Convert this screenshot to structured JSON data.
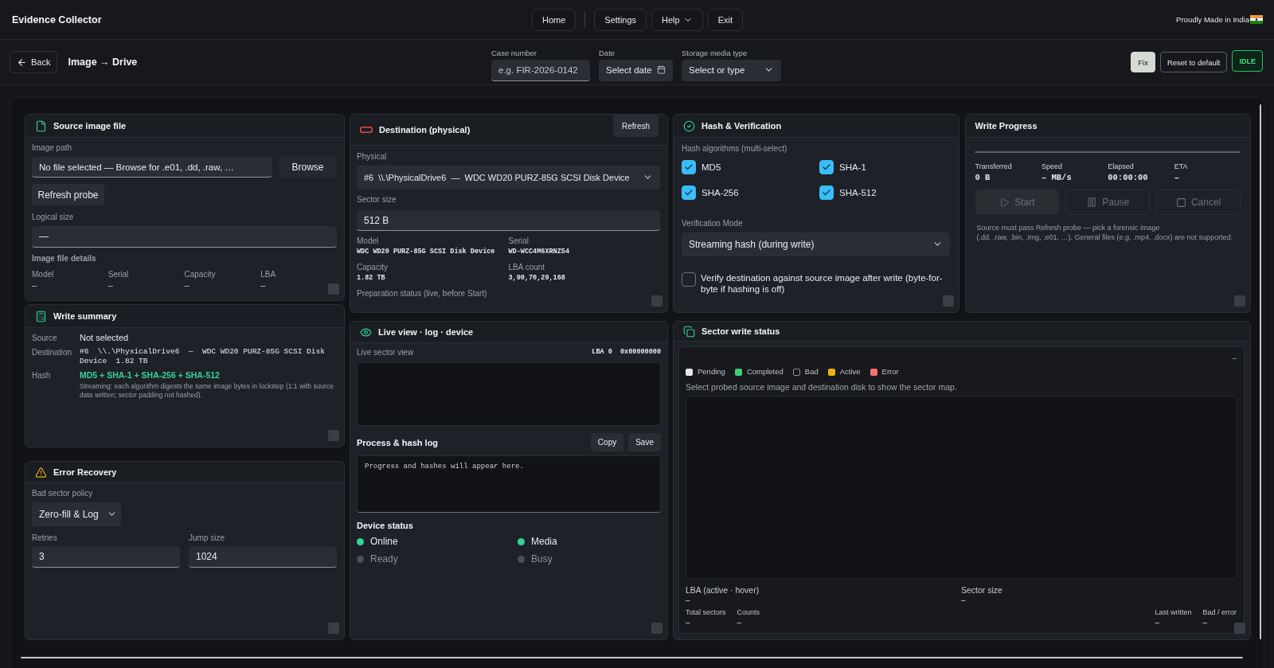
{
  "app": {
    "title": "Evidence Collector",
    "tagline": "Proudly Made in India"
  },
  "nav": [
    {
      "label": "Home",
      "kind": "button"
    },
    {
      "label": "Settings",
      "kind": "button"
    },
    {
      "label": "Help",
      "kind": "menu"
    },
    {
      "label": "Exit",
      "kind": "button"
    }
  ],
  "toolbar": {
    "back": "Back",
    "title": "Image → Drive",
    "fields": [
      {
        "label": "Case number",
        "kind": "text",
        "placeholder": "e.g. FIR-2026-0142"
      },
      {
        "label": "Date",
        "kind": "date",
        "placeholder": "Select date"
      },
      {
        "label": "Storage media type",
        "kind": "select",
        "placeholder": "Select or type"
      }
    ],
    "actions": [
      {
        "label": "Fix",
        "kind": "primary"
      },
      {
        "label": "Reset to default",
        "kind": "outline"
      }
    ],
    "status": "IDLE"
  },
  "source_image": {
    "title": "Source image file",
    "image_path": {
      "label": "Image path",
      "value": "No file selected — Browse for .e01, .dd, .raw, …"
    },
    "browse": "Browse",
    "refresh_probe": "Refresh probe",
    "logical_size": {
      "label": "Logical size",
      "value": "—"
    },
    "details_title": "Image file details",
    "details": [
      {
        "label": "Model",
        "value": "–"
      },
      {
        "label": "Serial",
        "value": "–"
      },
      {
        "label": "Capacity",
        "value": "–"
      },
      {
        "label": "LBA",
        "value": "–"
      }
    ]
  },
  "write_summary": {
    "title": "Write summary",
    "rows": [
      {
        "label": "Source",
        "kind": "text",
        "value": "Not selected"
      },
      {
        "label": "Destination",
        "kind": "mono",
        "value": "#6  \\\\.\\PhysicalDrive6  —  WDC WD20 PURZ-85G SCSI Disk Device  1.82 TB"
      },
      {
        "label": "Hash",
        "kind": "hash",
        "value": "MD5 + SHA-1 + SHA-256 + SHA-512",
        "note": "Streaming: each algorithm digests the same image bytes in lockstep (1:1 with source data written; sector padding not hashed)."
      }
    ]
  },
  "error_recovery": {
    "title": "Error Recovery",
    "policy": {
      "label": "Bad sector policy",
      "value": "Zero-fill & Log"
    },
    "fields": [
      {
        "label": "Retries",
        "value": "3"
      },
      {
        "label": "Jump size",
        "value": "1024"
      }
    ]
  },
  "destination": {
    "title": "Destination (physical)",
    "refresh": "Refresh",
    "physical": {
      "label": "Physical",
      "value": "#6  \\\\.\\PhysicalDrive6  —  WDC WD20 PURZ-85G SCSI Disk Device"
    },
    "sector_size": {
      "label": "Sector size",
      "value": "512 B"
    },
    "details": [
      {
        "label": "Model",
        "value": "WDC WD20 PURZ-85G SCSI Disk Device"
      },
      {
        "label": "Serial",
        "value": "WD-WCC4M6XRNZ54"
      },
      {
        "label": "Capacity",
        "value": "1.82 TB"
      },
      {
        "label": "LBA count",
        "value": "3,90,70,29,168"
      }
    ],
    "preparation_title": "Preparation status (live, before Start)"
  },
  "live_view": {
    "title": "Live view · log · device",
    "sector_view": {
      "label": "Live sector view",
      "position": "LBA 0  0x00000000"
    },
    "log": {
      "title": "Process & hash log",
      "buttons": [
        "Copy",
        "Save"
      ],
      "placeholder": "Progress and hashes will appear here."
    },
    "device_status": {
      "title": "Device status",
      "items": [
        {
          "label": "Online",
          "on": true
        },
        {
          "label": "Media",
          "on": true
        },
        {
          "label": "Ready",
          "on": false
        },
        {
          "label": "Busy",
          "on": false
        }
      ]
    }
  },
  "hash_verification": {
    "title": "Hash & Verification",
    "algorithms_label": "Hash algorithms (multi-select)",
    "algorithms": [
      {
        "label": "MD5",
        "checked": true
      },
      {
        "label": "SHA-1",
        "checked": true
      },
      {
        "label": "SHA-256",
        "checked": true
      },
      {
        "label": "SHA-512",
        "checked": true
      }
    ],
    "mode": {
      "label": "Verification Mode",
      "value": "Streaming hash (during write)"
    },
    "verify_after": {
      "label": "Verify destination against source image after write (byte-for-byte if hashing is off)",
      "checked": false
    }
  },
  "write_progress": {
    "title": "Write Progress",
    "progress": {
      "level": 0
    },
    "stats": [
      {
        "label": "Transferred",
        "value": "0 B"
      },
      {
        "label": "Speed",
        "value": "– MB/s"
      },
      {
        "label": "Elapsed",
        "value": "00:00:00"
      },
      {
        "label": "ETA",
        "value": "–"
      }
    ],
    "buttons": [
      {
        "label": "Start",
        "kind": "start",
        "disabled": true
      },
      {
        "label": "Pause",
        "kind": "pause",
        "disabled": true
      },
      {
        "label": "Cancel",
        "kind": "cancel",
        "disabled": true
      }
    ],
    "note": "Source must pass Refresh probe — pick a forensic image\n(.dd, .raw, .bin, .img, .e01, …). General files (e.g. .mp4, .docx) are not supported."
  },
  "sector_status": {
    "title": "Sector write status",
    "indicator": "–",
    "legend": [
      {
        "label": "Pending",
        "color": "#e5e7eb",
        "outlined": false
      },
      {
        "label": "Completed",
        "color": "#3ecf73",
        "outlined": false
      },
      {
        "label": "Bad",
        "color": "#17191d",
        "outlined": true
      },
      {
        "label": "Active",
        "color": "#eab308",
        "outlined": false
      },
      {
        "label": "Error",
        "color": "#f87171",
        "outlined": false
      }
    ],
    "message": "Select probed source image and destination disk to show the sector map.",
    "readouts": [
      {
        "label": "LBA (active · hover)",
        "value": "–"
      },
      {
        "label": "Sector size",
        "value": "–"
      }
    ],
    "totals": [
      {
        "label": "Total sectors",
        "value": "–"
      },
      {
        "label": "Counts",
        "value": "–"
      }
    ],
    "recent": [
      {
        "label": "Last written",
        "value": "–"
      },
      {
        "label": "Bad / error",
        "value": "–"
      }
    ]
  }
}
